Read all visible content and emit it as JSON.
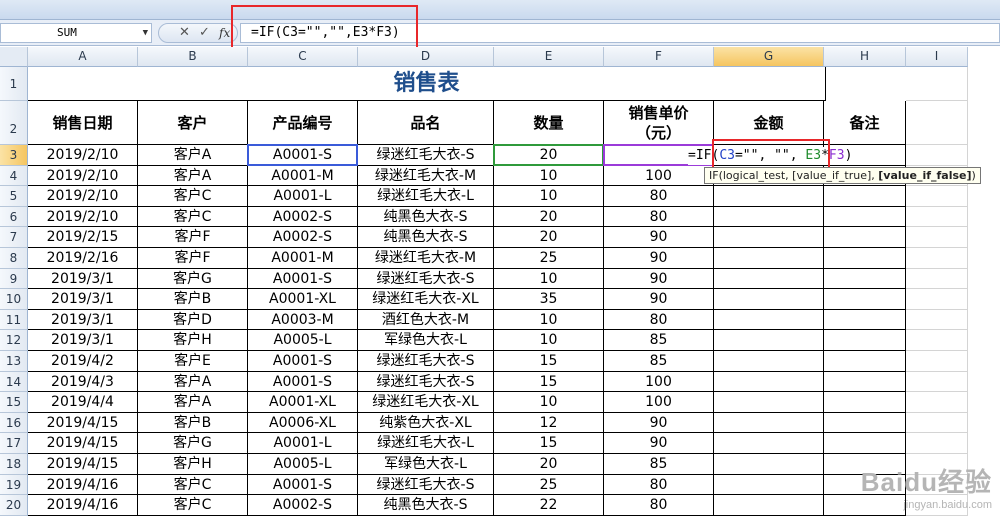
{
  "formula_bar": {
    "name_box": "SUM",
    "formula": "=IF(C3=\"\",\"\",E3*F3)",
    "cancel_icon": "✕",
    "enter_icon": "✓",
    "fx_icon": "fx"
  },
  "columns": [
    "A",
    "B",
    "C",
    "D",
    "E",
    "F",
    "G",
    "H",
    "I"
  ],
  "title": "销售表",
  "headers": {
    "date": "销售日期",
    "customer": "客户",
    "product_code": "产品编号",
    "product_name": "品名",
    "quantity": "数量",
    "unit_price_line1": "销售单价",
    "unit_price_line2": "（元）",
    "amount": "金额",
    "note": "备注"
  },
  "row_numbers": [
    "1",
    "2",
    "3",
    "4",
    "5",
    "6",
    "7",
    "8",
    "9",
    "10",
    "11",
    "12",
    "13",
    "14",
    "15",
    "16",
    "17",
    "18",
    "19",
    "20"
  ],
  "rows": [
    {
      "date": "2019/2/10",
      "customer": "客户A",
      "code": "A0001-S",
      "name": "绿迷红毛大衣-S",
      "qty": "20",
      "price": ""
    },
    {
      "date": "2019/2/10",
      "customer": "客户A",
      "code": "A0001-M",
      "name": "绿迷红毛大衣-M",
      "qty": "10",
      "price": "100"
    },
    {
      "date": "2019/2/10",
      "customer": "客户C",
      "code": "A0001-L",
      "name": "绿迷红毛大衣-L",
      "qty": "10",
      "price": "80"
    },
    {
      "date": "2019/2/10",
      "customer": "客户C",
      "code": "A0002-S",
      "name": "纯黑色大衣-S",
      "qty": "20",
      "price": "80"
    },
    {
      "date": "2019/2/15",
      "customer": "客户F",
      "code": "A0002-S",
      "name": "纯黑色大衣-S",
      "qty": "20",
      "price": "90"
    },
    {
      "date": "2019/2/16",
      "customer": "客户F",
      "code": "A0001-M",
      "name": "绿迷红毛大衣-M",
      "qty": "25",
      "price": "90"
    },
    {
      "date": "2019/3/1",
      "customer": "客户G",
      "code": "A0001-S",
      "name": "绿迷红毛大衣-S",
      "qty": "10",
      "price": "90"
    },
    {
      "date": "2019/3/1",
      "customer": "客户B",
      "code": "A0001-XL",
      "name": "绿迷红毛大衣-XL",
      "qty": "35",
      "price": "90"
    },
    {
      "date": "2019/3/1",
      "customer": "客户D",
      "code": "A0003-M",
      "name": "酒红色大衣-M",
      "qty": "10",
      "price": "80"
    },
    {
      "date": "2019/3/1",
      "customer": "客户H",
      "code": "A0005-L",
      "name": "军绿色大衣-L",
      "qty": "10",
      "price": "85"
    },
    {
      "date": "2019/4/2",
      "customer": "客户E",
      "code": "A0001-S",
      "name": "绿迷红毛大衣-S",
      "qty": "15",
      "price": "85"
    },
    {
      "date": "2019/4/3",
      "customer": "客户A",
      "code": "A0001-S",
      "name": "绿迷红毛大衣-S",
      "qty": "15",
      "price": "100"
    },
    {
      "date": "2019/4/4",
      "customer": "客户A",
      "code": "A0001-XL",
      "name": "绿迷红毛大衣-XL",
      "qty": "10",
      "price": "100"
    },
    {
      "date": "2019/4/15",
      "customer": "客户B",
      "code": "A0006-XL",
      "name": "纯紫色大衣-XL",
      "qty": "12",
      "price": "90"
    },
    {
      "date": "2019/4/15",
      "customer": "客户G",
      "code": "A0001-L",
      "name": "绿迷红毛大衣-L",
      "qty": "15",
      "price": "90"
    },
    {
      "date": "2019/4/15",
      "customer": "客户H",
      "code": "A0005-L",
      "name": "军绿色大衣-L",
      "qty": "20",
      "price": "85"
    },
    {
      "date": "2019/4/16",
      "customer": "客户C",
      "code": "A0001-S",
      "name": "绿迷红毛大衣-S",
      "qty": "25",
      "price": "80"
    },
    {
      "date": "2019/4/16",
      "customer": "客户C",
      "code": "A0002-S",
      "name": "纯黑色大衣-S",
      "qty": "22",
      "price": "80"
    }
  ],
  "in_cell_formula": {
    "prefix": "=IF(",
    "ref_c3": "C3",
    "mid": "=\"\", \"\", ",
    "ref_e3": "E3",
    "op": "*",
    "ref_f3": "F3",
    "suffix": ")"
  },
  "tooltip": {
    "text": "IF(logical_test, [value_if_true], ",
    "bold": "[value_if_false]",
    "end": ")"
  },
  "watermark": {
    "logo": "Baidu经验",
    "url": "jingyan.baidu.com"
  },
  "colors": {
    "title": "#1f4e8c",
    "highlight_red": "#e8272a",
    "ref_blue": "#2342c8",
    "ref_green": "#1d8a2a",
    "ref_purple": "#8a2bd0"
  }
}
